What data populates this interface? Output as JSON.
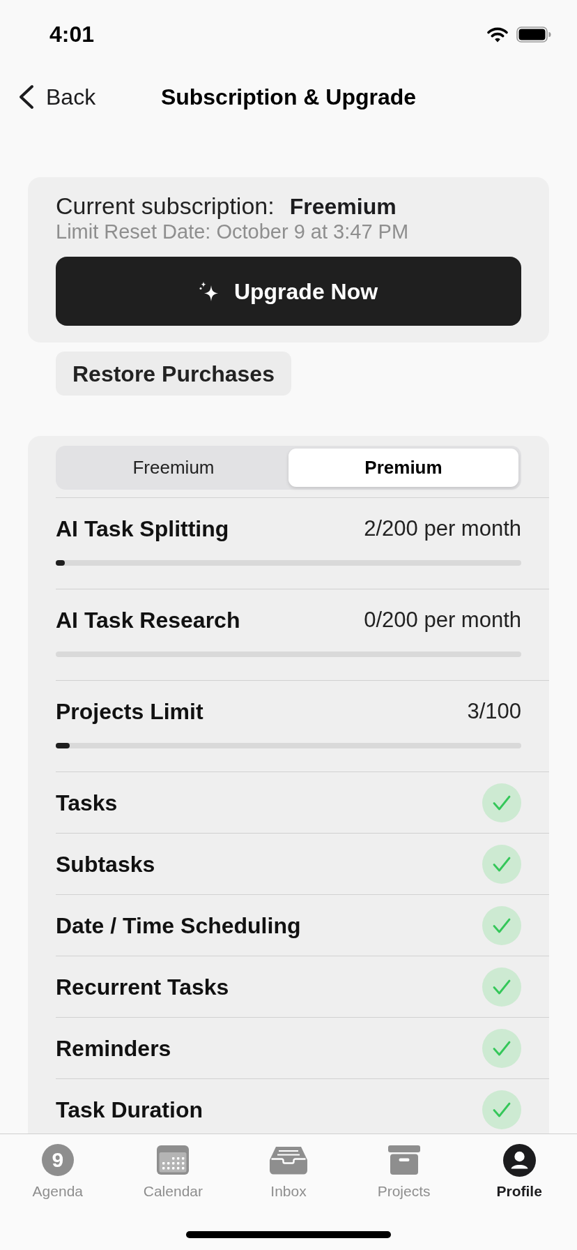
{
  "status_bar": {
    "time": "4:01"
  },
  "nav_bar": {
    "back_label": "Back",
    "title": "Subscription & Upgrade"
  },
  "subscription_card": {
    "label": "Current subscription:",
    "plan": "Freemium",
    "reset_date": "Limit Reset Date: October 9 at 3:47 PM",
    "upgrade_button": "Upgrade Now"
  },
  "restore_button": "Restore Purchases",
  "plan_tabs": [
    {
      "label": "Freemium",
      "selected": false
    },
    {
      "label": "Premium",
      "selected": true
    }
  ],
  "usage_limits": [
    {
      "name": "AI Task Splitting",
      "reading": "2/200 per month",
      "level": 0.02
    },
    {
      "name": "AI Task Research",
      "reading": "0/200 per month"
    },
    {
      "name": "Projects Limit",
      "reading": "3/100",
      "level": 0.03
    }
  ],
  "features": [
    {
      "name": "Tasks",
      "included": true
    },
    {
      "name": "Subtasks",
      "included": true
    },
    {
      "name": "Date / Time Scheduling",
      "included": true
    },
    {
      "name": "Recurrent Tasks",
      "included": true
    },
    {
      "name": "Reminders",
      "included": true
    },
    {
      "name": "Task Duration",
      "included": true
    }
  ],
  "tab_bar": [
    {
      "label": "Agenda",
      "kind": "date",
      "badge": "9",
      "selected": false
    },
    {
      "label": "Calendar",
      "kind": "calendar",
      "selected": false
    },
    {
      "label": "Inbox",
      "kind": "inbox",
      "selected": false
    },
    {
      "label": "Projects",
      "kind": "archive",
      "selected": false
    },
    {
      "label": "Profile",
      "kind": "profile",
      "selected": true
    }
  ]
}
